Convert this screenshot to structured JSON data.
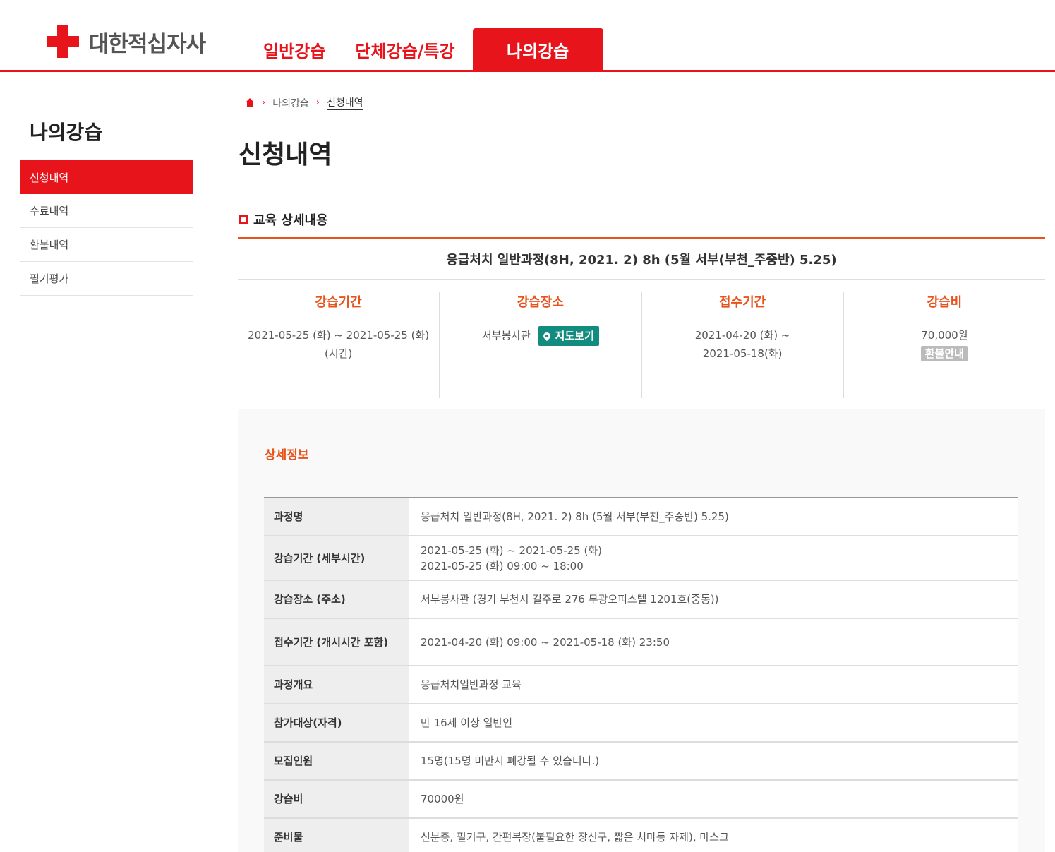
{
  "brand": {
    "name": "대한적십자사"
  },
  "gnb": {
    "items": [
      "일반강습",
      "단체강습/특강",
      "나의강습"
    ]
  },
  "sidebar": {
    "title": "나의강습",
    "items": [
      "신청내역",
      "수료내역",
      "환불내역",
      "필기평가"
    ]
  },
  "breadcrumb": {
    "level1": "나의강습",
    "current": "신청내역"
  },
  "page": {
    "title": "신청내역"
  },
  "section": {
    "title": "교육 상세내용"
  },
  "course": {
    "title": "응급처치 일반과정(8H, 2021. 2) 8h (5월 서부(부천_주중반) 5.25)",
    "period": {
      "label": "강습기간",
      "line1": "2021-05-25 (화) ~ 2021-05-25 (화)",
      "line2": "(시간)"
    },
    "place": {
      "label": "강습장소",
      "value": "서부봉사관",
      "map_button": "지도보기"
    },
    "reception": {
      "label": "접수기간",
      "line1": "2021-04-20 (화) ~",
      "line2": "2021-05-18(화)"
    },
    "fee": {
      "label": "강습비",
      "value": "70,000원",
      "refund_button": "환불안내"
    }
  },
  "detail": {
    "title": "상세정보",
    "rows": [
      {
        "label": "과정명",
        "value": "응급처치 일반과정(8H, 2021. 2) 8h (5월 서부(부천_주중반) 5.25)"
      },
      {
        "label": "강습기간 (세부시간)",
        "value": "2021-05-25 (화) ~ 2021-05-25 (화)",
        "value2": "2021-05-25 (화) 09:00 ~ 18:00"
      },
      {
        "label": "강습장소 (주소)",
        "value": "서부봉사관 (경기 부천시 길주로 276 무광오피스텔 1201호(중동))"
      },
      {
        "label": "접수기간 (개시시간 포함)",
        "value": "2021-04-20 (화) 09:00 ~ 2021-05-18 (화) 23:50"
      },
      {
        "label": "과정개요",
        "value": "응급처치일반과정 교육"
      },
      {
        "label": "참가대상(자격)",
        "value": "만 16세 이상 일반인"
      },
      {
        "label": "모집인원",
        "value": "15명(15명 미만시 폐강될 수 있습니다.)"
      },
      {
        "label": "강습비",
        "value": "70000원"
      },
      {
        "label": "준비물",
        "value": "신분증, 필기구, 간편복장(불필요한 장신구, 짧은 치마등 자제), 마스크"
      }
    ]
  },
  "colors": {
    "accent": "#e8141b",
    "orange": "#e8521b",
    "map_button": "#128c7e"
  }
}
